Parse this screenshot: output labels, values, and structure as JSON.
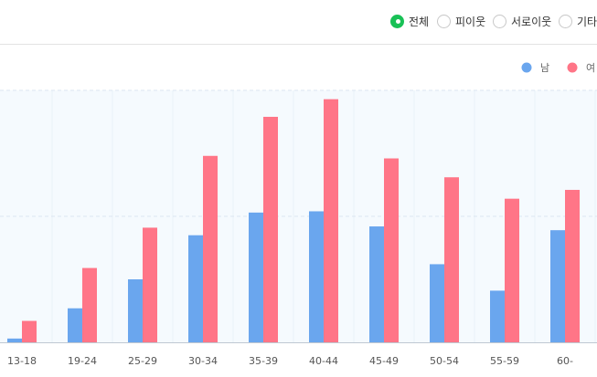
{
  "filters": {
    "options": [
      {
        "label": "전체",
        "checked": true
      },
      {
        "label": "피이웃",
        "checked": false
      },
      {
        "label": "서로이웃",
        "checked": false
      },
      {
        "label": "기타",
        "checked": false
      }
    ]
  },
  "colors": {
    "male": "#6aa6ee",
    "female": "#ff7587",
    "radio_checked": "#19c156",
    "plot_background": "#f5fafe",
    "grid": "#dbe6f2"
  },
  "chart_data": {
    "type": "bar",
    "categories": [
      "13-18",
      "19-24",
      "25-29",
      "30-34",
      "35-39",
      "40-44",
      "45-49",
      "50-54",
      "55-59",
      "60-"
    ],
    "series": [
      {
        "name": "남",
        "values": [
          3,
          27,
          50,
          85,
          103,
          104,
          92,
          62,
          41,
          89
        ]
      },
      {
        "name": "여",
        "values": [
          17,
          59,
          91,
          148,
          179,
          193,
          146,
          131,
          114,
          121
        ]
      }
    ],
    "ylim": [
      0,
      200
    ],
    "grid": true,
    "legend": "top-right",
    "title": "",
    "xlabel": "",
    "ylabel": ""
  }
}
